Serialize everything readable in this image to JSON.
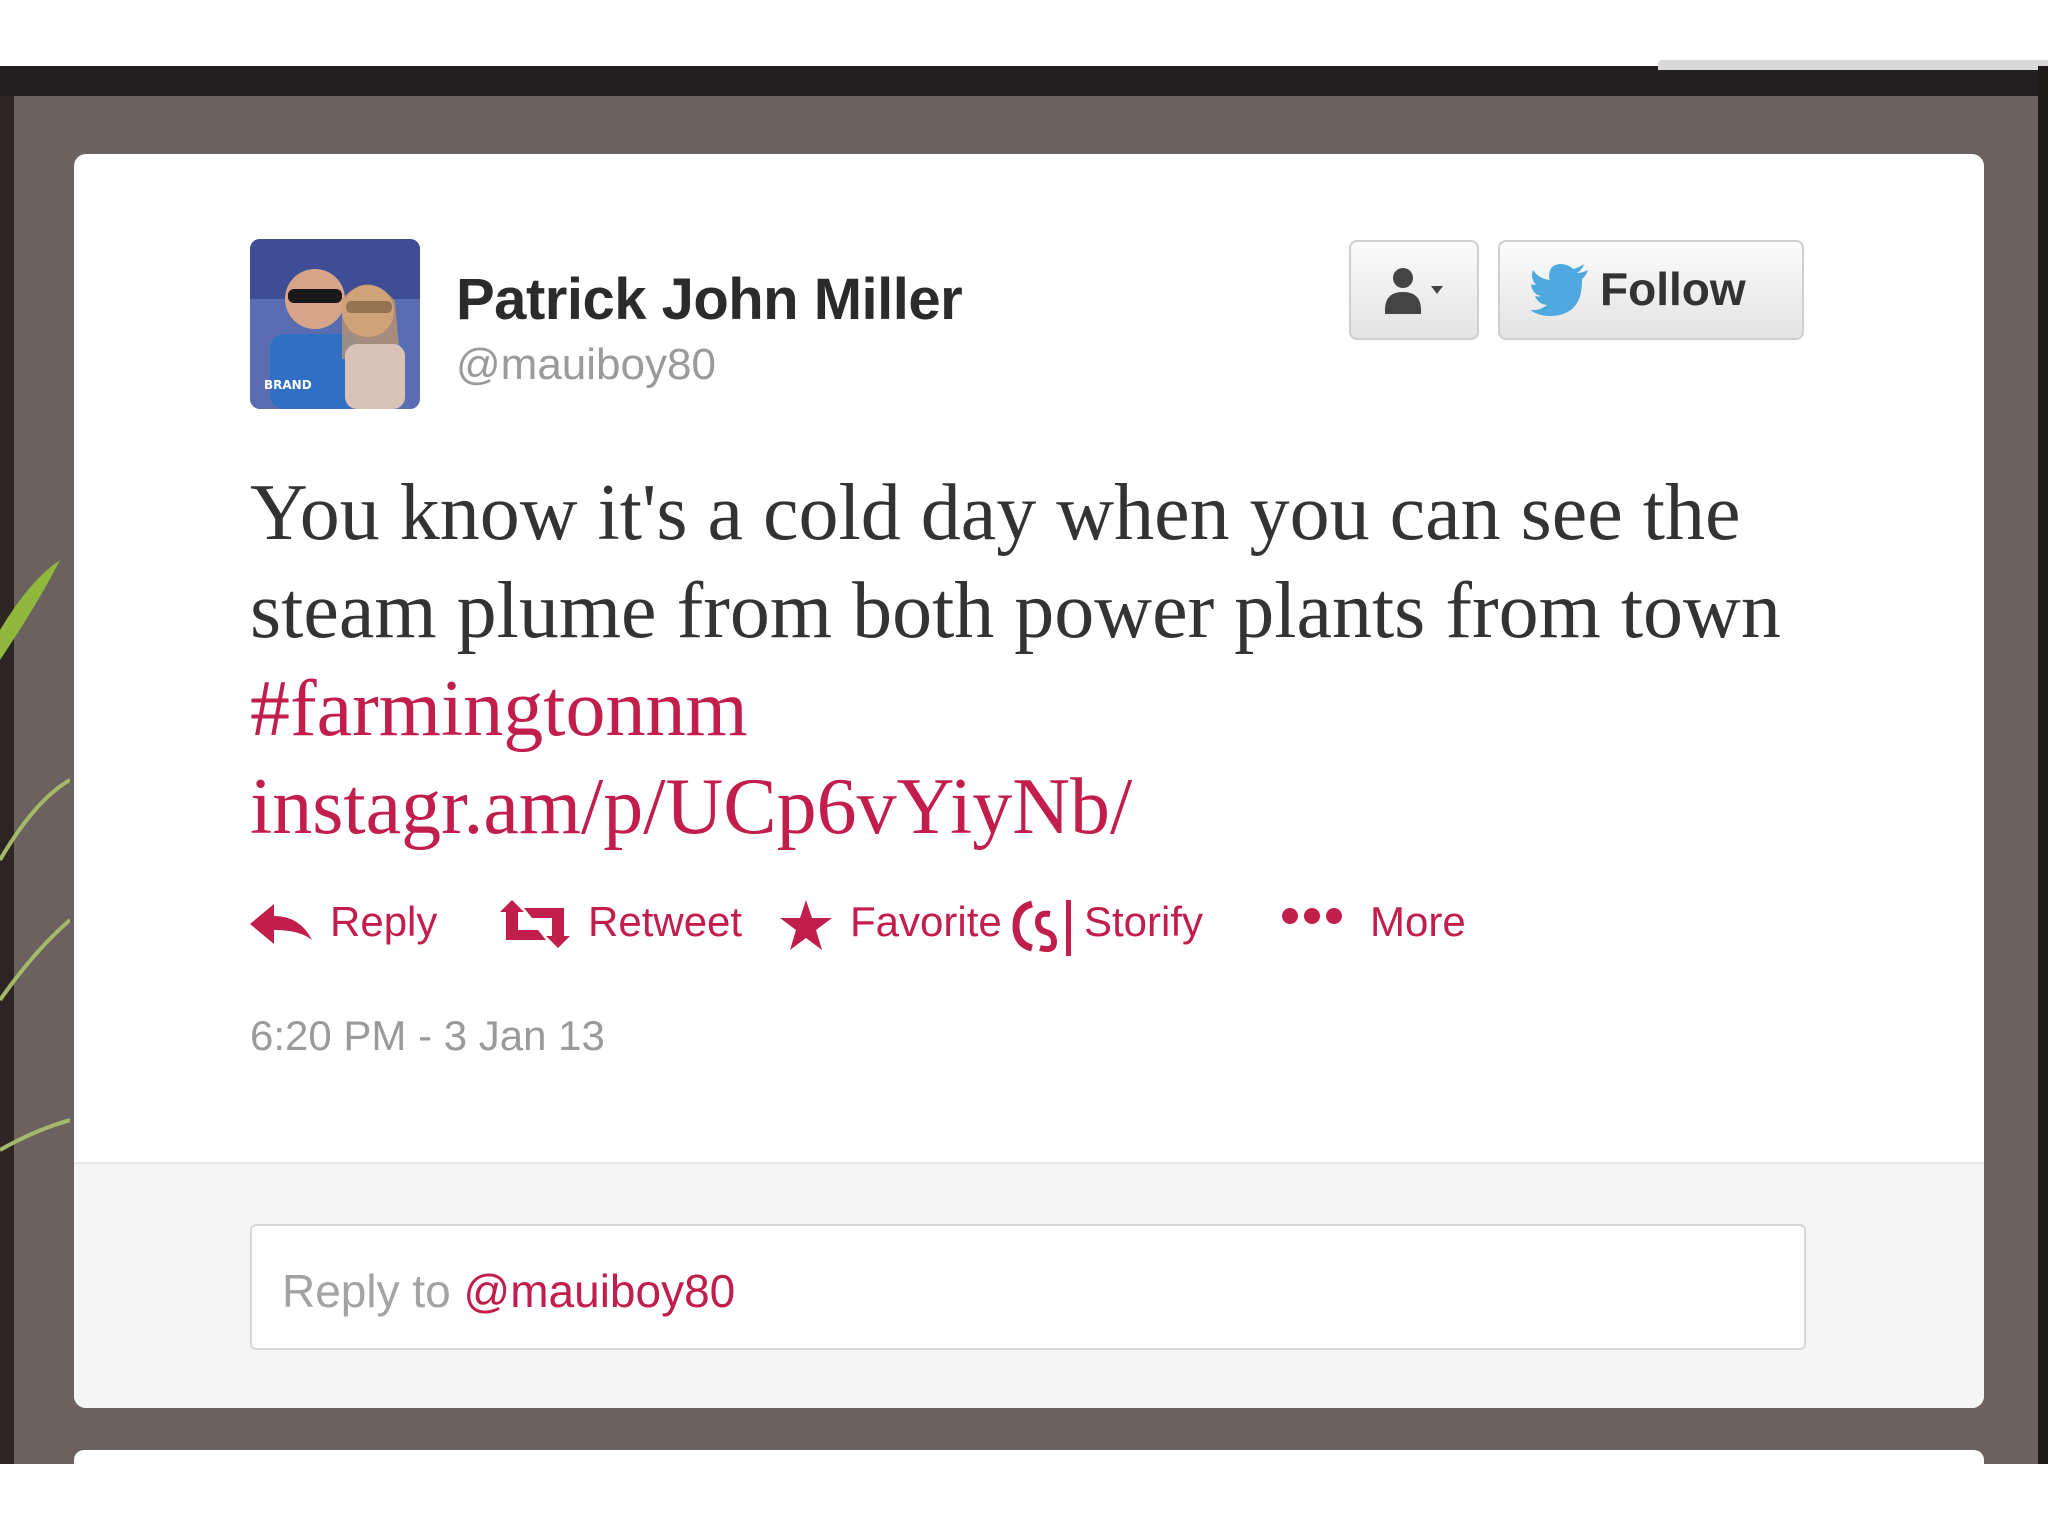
{
  "tweet": {
    "author_name": "Patrick John Miller",
    "author_handle": "@mauiboy80",
    "text_main": "You know it's a cold day when you can see the steam plume from both power plants from town ",
    "hashtag": "#farmingtonnm",
    "link": "instagr.am/p/UCp6vYiyNb/",
    "timestamp": "6:20 PM - 3 Jan 13"
  },
  "buttons": {
    "follow_label": "Follow"
  },
  "actions": {
    "reply_label": "Reply",
    "retweet_label": "Retweet",
    "favorite_label": "Favorite",
    "storify_label": "Storify",
    "more_label": "More"
  },
  "reply_box": {
    "prefix": "Reply to ",
    "mention": "@mauiboy80"
  },
  "colors": {
    "accent": "#c21e4b",
    "backdrop": "#6b625f",
    "twitter_blue": "#4fa8e0"
  },
  "icons": [
    "user-dropdown-icon",
    "twitter-bird-icon",
    "reply-arrow-icon",
    "retweet-icon",
    "star-icon",
    "storify-icon",
    "more-dots-icon"
  ]
}
